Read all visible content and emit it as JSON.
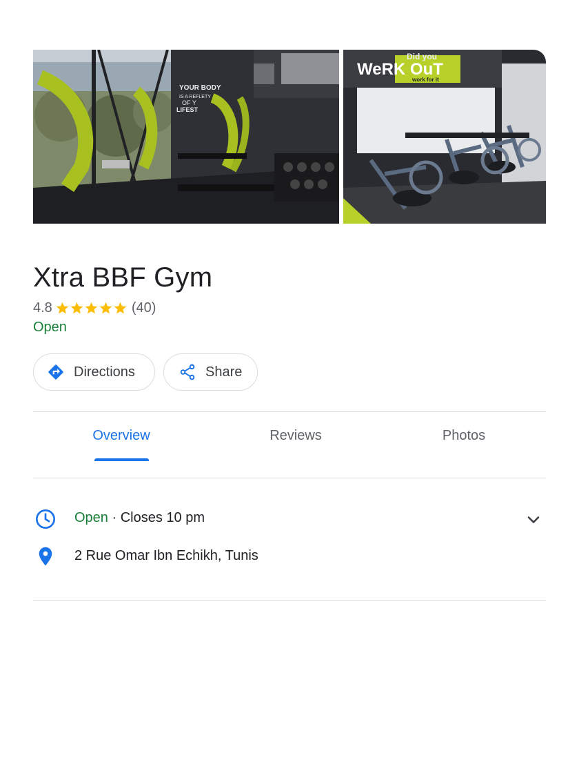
{
  "place": {
    "name": "Xtra BBF Gym",
    "rating": "4.8",
    "stars": 5,
    "review_count": "(40)",
    "status": "Open"
  },
  "photos": {
    "sign_lines": [
      "YOUR BODY",
      "IS A REFLETY",
      "OF Y",
      "LIFEST"
    ],
    "banner_title": "WeRK OuT",
    "banner_sub": "work for it",
    "banner_top": "Did you"
  },
  "actions": {
    "directions_label": "Directions",
    "share_label": "Share"
  },
  "tabs": [
    {
      "label": "Overview",
      "active": true
    },
    {
      "label": "Reviews",
      "active": false
    },
    {
      "label": "Photos",
      "active": false
    }
  ],
  "info": {
    "hours_status": "Open",
    "hours_detail": " · Closes 10 pm",
    "address": "2 Rue Omar Ibn Echikh, Tunis"
  },
  "colors": {
    "accent": "#1a73e8",
    "open_green": "#188038",
    "star_yellow": "#fbbc04",
    "gym_green": "#a8c020"
  },
  "icons": {
    "directions": "directions-diamond-icon",
    "share": "share-icon",
    "hours": "clock-icon",
    "address": "map-pin-icon",
    "expand": "chevron-down-icon"
  }
}
